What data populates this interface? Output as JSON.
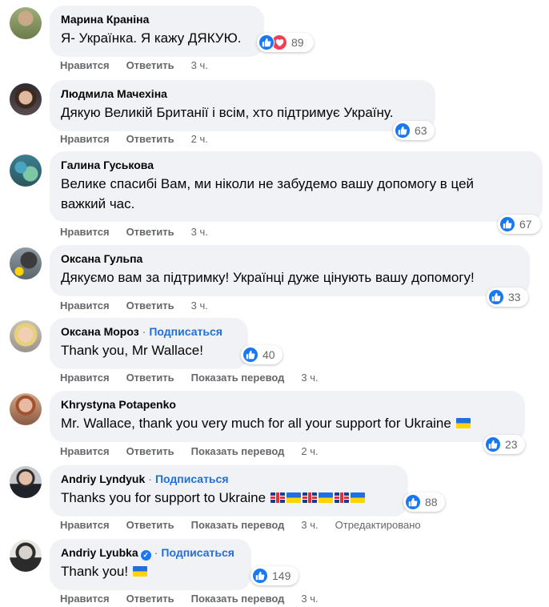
{
  "comments": [
    {
      "author": "Марина Краніна",
      "follow": "",
      "verified": false,
      "text": "Я- Українка. Я кажу ДЯКУЮ.",
      "text2": "",
      "reactions": [
        "like",
        "love"
      ],
      "count": "89",
      "like": "Нравится",
      "reply": "Ответить",
      "translate": "",
      "time": "3 ч.",
      "edited": ""
    },
    {
      "author": "Людмила Мачехіна",
      "follow": "",
      "verified": false,
      "text": "Дякую Великій Британії і всім, хто підтримує Україну.",
      "text2": "",
      "reactions": [
        "like"
      ],
      "count": "63",
      "like": "Нравится",
      "reply": "Ответить",
      "translate": "",
      "time": "2 ч.",
      "edited": ""
    },
    {
      "author": "Галина Гуськова",
      "follow": "",
      "verified": false,
      "text": "Велике спасибі Вам, ми ніколи не забудемо вашу допомогу в цей",
      "text2": "важкий час.",
      "reactions": [
        "like"
      ],
      "count": "67",
      "like": "Нравится",
      "reply": "Ответить",
      "translate": "",
      "time": "3 ч.",
      "edited": ""
    },
    {
      "author": "Оксана Гульпа",
      "follow": "",
      "verified": false,
      "text": "Дякуємо вам за підтримку! Українці дуже цінують вашу допомогу!",
      "text2": "",
      "reactions": [
        "like"
      ],
      "count": "33",
      "like": "Нравится",
      "reply": "Ответить",
      "translate": "",
      "time": "3 ч.",
      "edited": ""
    },
    {
      "author": "Оксана Мороз",
      "follow": "Подписаться",
      "verified": false,
      "text": "Thank you, Mr Wallace!",
      "text2": "",
      "reactions": [
        "like"
      ],
      "count": "40",
      "like": "Нравится",
      "reply": "Ответить",
      "translate": "Показать перевод",
      "time": "3 ч.",
      "edited": ""
    },
    {
      "author": "Khrystyna Potapenko",
      "follow": "",
      "verified": false,
      "text": "Mr. Wallace, thank you very much for all your support for Ukraine",
      "text2": "",
      "reactions": [
        "like"
      ],
      "count": "23",
      "like": "Нравится",
      "reply": "Ответить",
      "translate": "Показать перевод",
      "time": "2 ч.",
      "edited": ""
    },
    {
      "author": "Andriy Lyndyuk",
      "follow": "Подписаться",
      "verified": false,
      "text": "Thanks you for support to Ukraine",
      "text2": "",
      "reactions": [
        "like"
      ],
      "count": "88",
      "like": "Нравится",
      "reply": "Ответить",
      "translate": "Показать перевод",
      "time": "3 ч.",
      "edited": "Отредактировано"
    },
    {
      "author": "Andriy Lyubka",
      "follow": "Подписаться",
      "verified": true,
      "text": "Thank you!",
      "text2": "",
      "reactions": [
        "like"
      ],
      "count": "149",
      "like": "Нравится",
      "reply": "Ответить",
      "translate": "Показать перевод",
      "time": "3 ч.",
      "edited": ""
    }
  ],
  "colors": {
    "accent": "#1877f2",
    "link": "#216fdb",
    "bubble": "#f0f2f5",
    "muted": "#65676b",
    "love": "#f33e58"
  },
  "icons": {
    "like": "thumbs-up-icon",
    "love": "heart-icon",
    "verified": "verified-badge-icon",
    "flag_ua": "ukraine-flag",
    "flag_gb": "uk-flag"
  }
}
